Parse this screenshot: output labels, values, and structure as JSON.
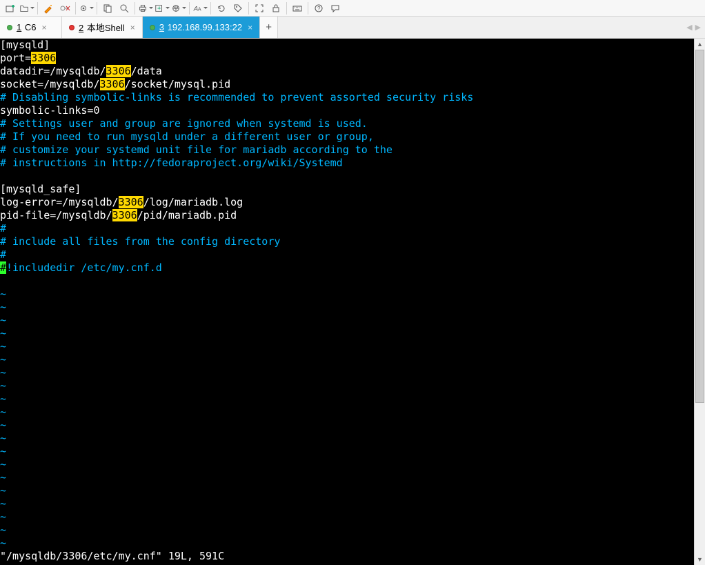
{
  "tabs": [
    {
      "num": "1",
      "label": "C6",
      "dot": "green"
    },
    {
      "num": "2",
      "label": "本地Shell",
      "dot": "red"
    },
    {
      "num": "3",
      "label": "192.168.99.133:22",
      "dot": "green",
      "active": true
    }
  ],
  "terminal": {
    "lines": [
      {
        "t": "plain",
        "parts": [
          {
            "c": "white",
            "s": "[mysqld]"
          }
        ]
      },
      {
        "t": "plain",
        "parts": [
          {
            "c": "white",
            "s": "port="
          },
          {
            "c": "hl",
            "s": "3306"
          }
        ]
      },
      {
        "t": "plain",
        "parts": [
          {
            "c": "white",
            "s": "datadir=/mysqldb/"
          },
          {
            "c": "hl",
            "s": "3306"
          },
          {
            "c": "white",
            "s": "/data"
          }
        ]
      },
      {
        "t": "plain",
        "parts": [
          {
            "c": "white",
            "s": "socket=/mysqldb/"
          },
          {
            "c": "hl",
            "s": "3306"
          },
          {
            "c": "white",
            "s": "/socket/mysql.pid"
          }
        ]
      },
      {
        "t": "plain",
        "parts": [
          {
            "c": "cyan",
            "s": "# Disabling symbolic-links is recommended to prevent assorted security risks"
          }
        ]
      },
      {
        "t": "plain",
        "parts": [
          {
            "c": "white",
            "s": "symbolic-links=0"
          }
        ]
      },
      {
        "t": "plain",
        "parts": [
          {
            "c": "cyan",
            "s": "# Settings user and group are ignored when systemd is used."
          }
        ]
      },
      {
        "t": "plain",
        "parts": [
          {
            "c": "cyan",
            "s": "# If you need to run mysqld under a different user or group,"
          }
        ]
      },
      {
        "t": "plain",
        "parts": [
          {
            "c": "cyan",
            "s": "# customize your systemd unit file for mariadb according to the"
          }
        ]
      },
      {
        "t": "plain",
        "parts": [
          {
            "c": "cyan",
            "s": "# instructions in http://fedoraproject.org/wiki/Systemd"
          }
        ]
      },
      {
        "t": "plain",
        "parts": [
          {
            "c": "white",
            "s": ""
          }
        ]
      },
      {
        "t": "plain",
        "parts": [
          {
            "c": "white",
            "s": "[mysqld_safe]"
          }
        ]
      },
      {
        "t": "plain",
        "parts": [
          {
            "c": "white",
            "s": "log-error=/mysqldb/"
          },
          {
            "c": "hl",
            "s": "3306"
          },
          {
            "c": "white",
            "s": "/log/mariadb.log"
          }
        ]
      },
      {
        "t": "plain",
        "parts": [
          {
            "c": "white",
            "s": "pid-file=/mysqldb/"
          },
          {
            "c": "hl",
            "s": "3306"
          },
          {
            "c": "white",
            "s": "/pid/mariadb.pid"
          }
        ]
      },
      {
        "t": "plain",
        "parts": [
          {
            "c": "cyan",
            "s": "#"
          }
        ]
      },
      {
        "t": "plain",
        "parts": [
          {
            "c": "cyan",
            "s": "# include all files from the config directory"
          }
        ]
      },
      {
        "t": "plain",
        "parts": [
          {
            "c": "cyan",
            "s": "#"
          }
        ]
      },
      {
        "t": "plain",
        "parts": [
          {
            "c": "cursor",
            "s": "#"
          },
          {
            "c": "cyan",
            "s": "!includedir /etc/my.cnf.d"
          }
        ]
      },
      {
        "t": "plain",
        "parts": [
          {
            "c": "white",
            "s": ""
          }
        ]
      }
    ],
    "tilde_count": 20,
    "tilde": "~",
    "status": "\"/mysqldb/3306/etc/my.cnf\" 19L, 591C"
  }
}
